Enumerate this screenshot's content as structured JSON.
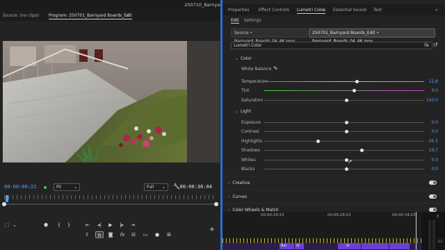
{
  "window": {
    "title": "250710_Barnyard-Boards - Edited"
  },
  "program_monitor": {
    "source_tab": "Source: (no clips)",
    "program_tab": "Program: 250701_Barnyard Boards_Edit",
    "program_tab_menu": "≡",
    "current_timecode": "00:00:00:22",
    "zoom_value": "Fit",
    "resolution_value": "Full",
    "duration_timecode": "00:00:36:04"
  },
  "right_panel": {
    "tabs": [
      "Properties",
      "Effect Controls",
      "Lumetri Color",
      "Essential Sound",
      "Text"
    ],
    "active_tab_menu": "≡",
    "more_menu": "»",
    "subtabs": [
      "Edit",
      "Settings"
    ],
    "source_clip": "Source • Barnyard_Boards_04_4K.mov",
    "program_clip": "250701_Barnyard Boards_Edit • Barnyard_Boards_04_4K.mov",
    "effect_select": "Lumetri Color",
    "fx_label": "fx"
  },
  "lumetri": {
    "color_section": "Color",
    "white_balance_label": "White Balance",
    "light_section": "Light",
    "params": [
      {
        "name": "Temperature",
        "value": "12.8"
      },
      {
        "name": "Tint",
        "value": "9.0"
      },
      {
        "name": "Saturation",
        "value": "100.0"
      },
      {
        "name": "Exposure",
        "value": "0.0"
      },
      {
        "name": "Contrast",
        "value": "0.0"
      },
      {
        "name": "Highlights",
        "value": "-35.5"
      },
      {
        "name": "Shadows",
        "value": "19.7"
      },
      {
        "name": "Whites",
        "value": "0.0"
      },
      {
        "name": "Blacks",
        "value": "0.0"
      }
    ],
    "groups": [
      "Creative",
      "Curves",
      "Color Wheels & Match"
    ]
  },
  "timeline": {
    "times": [
      "00:00:24:23",
      "00:00:29:23",
      "00:00:34:23"
    ],
    "clips": [
      "Bar",
      "fx",
      "fx"
    ],
    "meter_labels": [
      "0",
      "-12"
    ]
  },
  "colors": {
    "accent_blue": "#4da3ff",
    "panel_focus": "#2b6fd6",
    "clip_purple": "#6a3fd6",
    "ruler_yellow": "#e8c62e"
  }
}
